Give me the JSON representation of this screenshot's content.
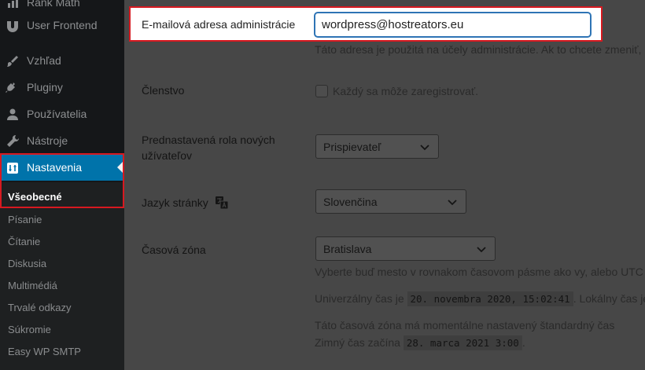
{
  "sidebar": {
    "items": [
      {
        "label": "Rank Math",
        "icon": "rank-math-icon"
      },
      {
        "label": "User Frontend",
        "icon": "user-frontend-icon"
      },
      {
        "label": "Vzhľad",
        "icon": "paintbrush-icon"
      },
      {
        "label": "Pluginy",
        "icon": "plugin-icon"
      },
      {
        "label": "Používatelia",
        "icon": "users-icon"
      },
      {
        "label": "Nástroje",
        "icon": "wrench-icon"
      },
      {
        "label": "Nastavenia",
        "icon": "settings-icon"
      }
    ],
    "submenu": [
      "Všeobecné",
      "Písanie",
      "Čítanie",
      "Diskusia",
      "Multimédiá",
      "Trvalé odkazy",
      "Súkromie",
      "Easy WP SMTP"
    ]
  },
  "form": {
    "email": {
      "label": "E-mailová adresa administrácie",
      "value": "wordpress@hostreators.eu",
      "desc": "Táto adresa je použitá na účely administrácie. Ak to chcete zmeniť, p"
    },
    "membership": {
      "label": "Členstvo",
      "checkbox_label": "Každý sa môže zaregistrovať."
    },
    "role": {
      "label_line1": "Prednastavená rola nových",
      "label_line2": "užívateľov",
      "value": "Prispievateľ"
    },
    "language": {
      "label": "Jazyk stránky",
      "value": "Slovenčina",
      "icon": "translation-icon"
    },
    "timezone": {
      "label": "Časová zóna",
      "value": "Bratislava",
      "desc": "Vyberte buď mesto v rovnakom časovom pásme ako vy, alebo UTC (",
      "utc_prefix": "Univerzálny čas je",
      "utc_value": "20. novembra 2020, 15:02:41",
      "local_prefix": ". Lokálny čas je",
      "standard_note": "Táto časová zóna má momentálne nastavený štandardný čas",
      "winter_prefix": "Zimný čas začína",
      "winter_value": "28. marca 2021 3:00",
      "winter_suffix": "."
    }
  }
}
